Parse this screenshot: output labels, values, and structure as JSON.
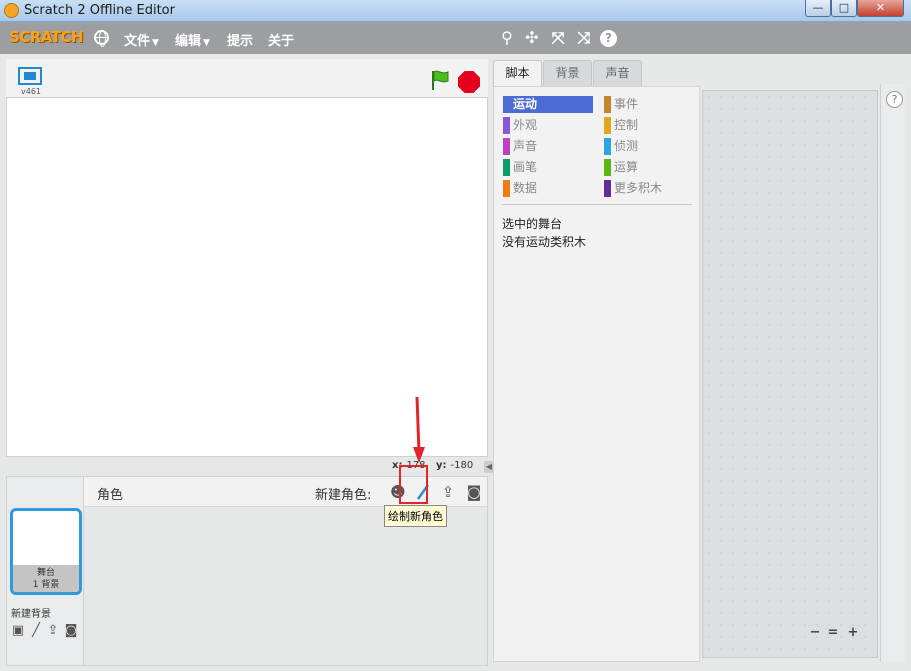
{
  "window": {
    "title": "Scratch 2 Offline Editor",
    "min": "—",
    "max": "□",
    "close": "✕"
  },
  "menubar": {
    "logo": "SCRATCH",
    "items": [
      {
        "label": "文件",
        "caret": "▼"
      },
      {
        "label": "编辑",
        "caret": "▼"
      },
      {
        "label": "提示"
      },
      {
        "label": "关于"
      }
    ],
    "tools": {
      "duplicate": "⚲",
      "delete": "✣",
      "grow": "⤧",
      "shrink": "⤨",
      "help": "?"
    }
  },
  "stage": {
    "version": "v461",
    "coords": {
      "x_label": "x:",
      "x_value": "178",
      "y_label": "y:",
      "y_value": "-180"
    }
  },
  "sprites": {
    "title": "角色",
    "new_sprite_label": "新建角色:",
    "paint_tooltip": "绘制新角色",
    "stage_thumb": {
      "name": "舞台",
      "sub": "1 背景"
    },
    "new_backdrop_label": "新建背景"
  },
  "tabs": [
    {
      "label": "脚本"
    },
    {
      "label": "背景"
    },
    {
      "label": "声音"
    }
  ],
  "palette": {
    "categories": [
      {
        "label": "运动",
        "color": "#4a6cd4"
      },
      {
        "label": "外观",
        "color": "#8a55d7"
      },
      {
        "label": "声音",
        "color": "#bb42c3"
      },
      {
        "label": "画笔",
        "color": "#0e9a6c"
      },
      {
        "label": "数据",
        "color": "#ee7d16"
      },
      {
        "label": "事件",
        "color": "#c88330"
      },
      {
        "label": "控制",
        "color": "#e1a91a"
      },
      {
        "label": "侦测",
        "color": "#2ca5e2"
      },
      {
        "label": "运算",
        "color": "#5cb712"
      },
      {
        "label": "更多积木",
        "color": "#632d99"
      }
    ],
    "selected_text": "选中的舞台",
    "empty_text": "没有运动类积木"
  },
  "scripts": {
    "help": "?",
    "zoom_out": "−",
    "zoom_reset": "=",
    "zoom_in": "+"
  }
}
